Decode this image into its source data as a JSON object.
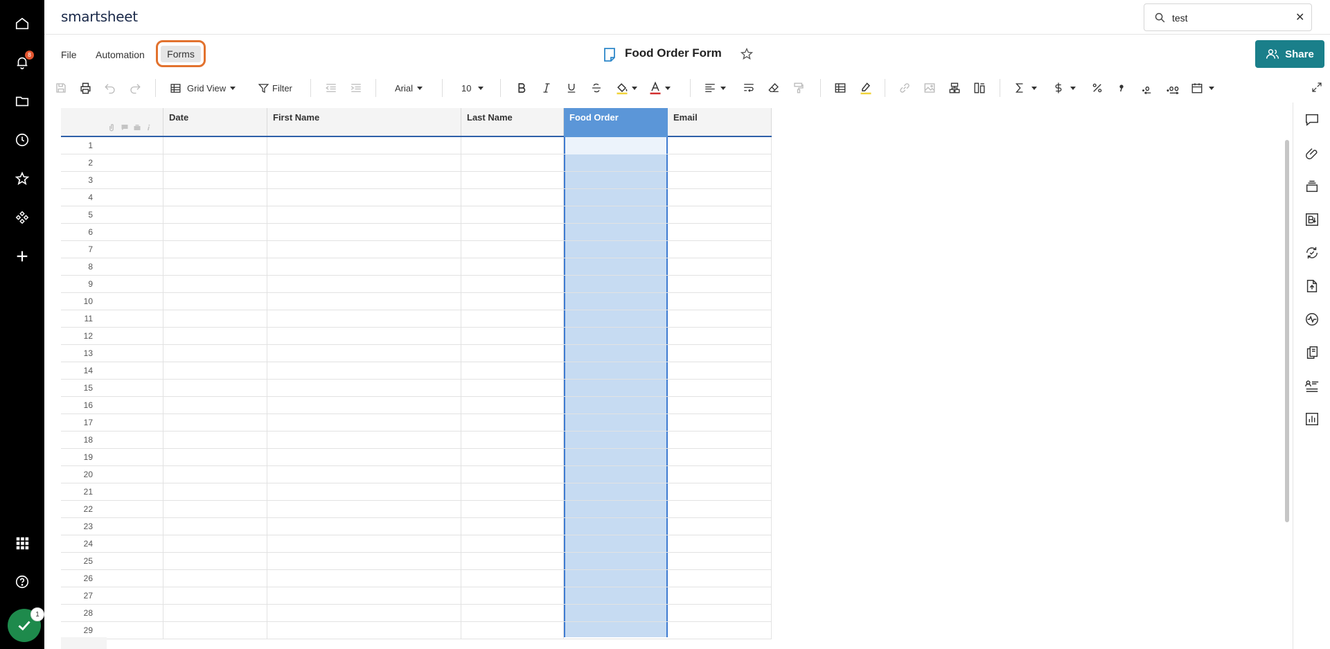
{
  "app": {
    "logo": "smartsheet",
    "notification_count": "8",
    "avatar_badge": "1"
  },
  "search": {
    "value": "test",
    "clear": "✕"
  },
  "menu": {
    "file": "File",
    "automation": "Automation",
    "forms": "Forms"
  },
  "sheet": {
    "title": "Food Order Form",
    "share_label": "Share"
  },
  "toolbar": {
    "view": "Grid View",
    "filter": "Filter",
    "font": "Arial",
    "font_size": "10"
  },
  "grid": {
    "columns": [
      "Date",
      "First Name",
      "Last Name",
      "Food Order",
      "Email"
    ],
    "selected_column": "Food Order",
    "rows": [
      "1",
      "2",
      "3",
      "4",
      "5",
      "6",
      "7",
      "8",
      "9",
      "10",
      "11",
      "12",
      "13",
      "14",
      "15",
      "16",
      "17",
      "18",
      "19",
      "20",
      "21",
      "22",
      "23",
      "24",
      "25",
      "26",
      "27",
      "28",
      "29"
    ]
  },
  "colors": {
    "nav_bg": "#000000",
    "share_bg": "#1a7f8a",
    "selected_col": "#c6dbf2",
    "selected_head": "#5b96d8",
    "highlight": "#e2722e"
  },
  "icons": {
    "left_nav": [
      "home-icon",
      "bell-icon",
      "folder-icon",
      "clock-icon",
      "star-icon",
      "solutions-icon",
      "plus-icon",
      "apps-grid-icon",
      "help-icon"
    ],
    "right_rail": [
      "comment-icon",
      "attachment-icon",
      "proofing-icon",
      "summary-icon",
      "update-requests-icon",
      "publish-icon",
      "activity-icon",
      "connections-icon",
      "forms-icon",
      "reports-icon"
    ]
  }
}
